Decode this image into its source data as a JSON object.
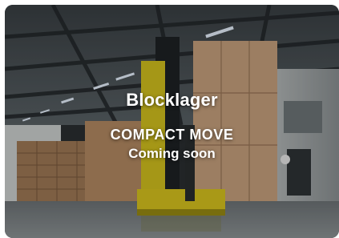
{
  "card": {
    "title": "Blocklager",
    "subtitle": "COMPACT MOVE",
    "status": "Coming soon"
  }
}
